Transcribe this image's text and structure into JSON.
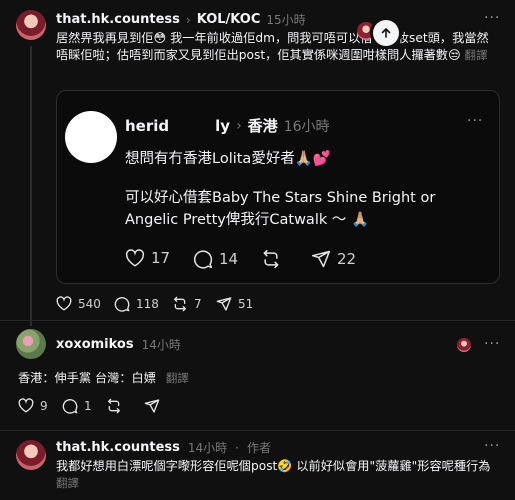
{
  "post1": {
    "username": "that.hk.countess",
    "badge": "KOL/KOC",
    "time": "15小時",
    "text": "居然畀我再見到佢😳 我一年前收過佢dm，問我可唔可以借佢化妝set頭，我當然唔睬佢啦；估唔到而家又見到佢出post，佢其實係咪週圍咁樣問人攞著數😒",
    "translate": "翻譯",
    "quote": {
      "username": "herid",
      "username_tail": "ly",
      "location": "香港",
      "time": "16小時",
      "line1": "想問有冇香港Lolita愛好者🙏🏼💕",
      "line2": "可以好心借套Baby The Stars Shine Bright or Angelic Pretty俾我行Catwalk ～ 🙏🏼",
      "likes": "17",
      "replies": "14",
      "shares": "22"
    },
    "likes": "540",
    "replies": "118",
    "reposts": "7",
    "shares": "51"
  },
  "post2": {
    "username": "xoxomikos",
    "time": "14小時",
    "text": "香港：伸手黨 台灣：白嫖",
    "translate": "翻譯",
    "likes": "9",
    "replies": "1"
  },
  "post3": {
    "username": "that.hk.countess",
    "time": "14小時",
    "author_tag": "作者",
    "text": "我都好想用白漂呢個字嚟形容佢呢個post🤣 以前好似會用\"菠蘿雞\"形容呢種行為",
    "translate": "翻譯"
  },
  "icons": {
    "heart": "heart-icon",
    "reply": "comment-icon",
    "repost": "repost-icon",
    "share": "send-icon",
    "more": "more-icon",
    "scroll_up": "arrow-up-icon"
  },
  "colors": {
    "background": "#101010",
    "muted": "#777777",
    "text": "#f3f5f7"
  }
}
